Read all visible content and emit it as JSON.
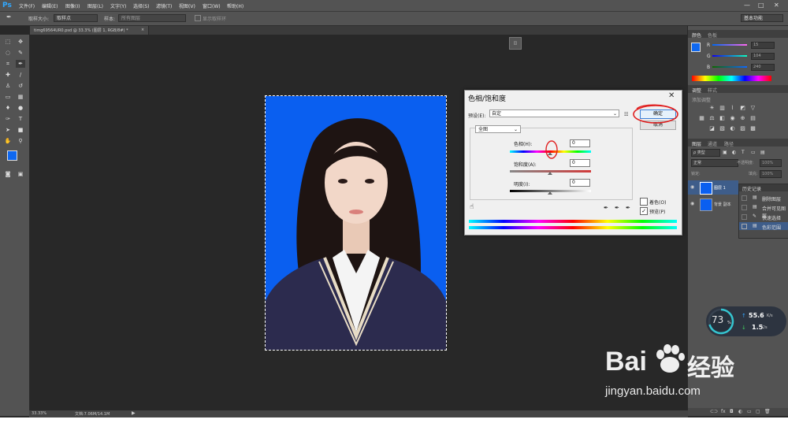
{
  "app": {
    "logo": "Ps"
  },
  "menu": [
    "文件(F)",
    "编辑(E)",
    "图像(I)",
    "图层(L)",
    "文字(Y)",
    "选择(S)",
    "滤镜(T)",
    "视图(V)",
    "窗口(W)",
    "帮助(H)"
  ],
  "window_controls": {
    "minimize": "—",
    "maximize": "□",
    "close": "✕"
  },
  "options": {
    "sample_size_label": "取样大小:",
    "sample_size_value": "取样点",
    "sample_label": "样本:",
    "sample_value": "所有图层",
    "show_ring_label": "显示取样环",
    "workspace": "基本功能"
  },
  "document": {
    "tab_title": "timg69564UR0.psd @ 33.3% (图层 1, RGB/8#) *",
    "tab_close": "×"
  },
  "tools": [
    "move-tool",
    "marquee-tool",
    "lasso-tool",
    "quick-select-tool",
    "crop-tool",
    "eyedropper-tool",
    "healing-tool",
    "brush-tool",
    "stamp-tool",
    "history-brush-tool",
    "eraser-tool",
    "gradient-tool",
    "blur-tool",
    "dodge-tool",
    "pen-tool",
    "type-tool",
    "path-select-tool",
    "shape-tool",
    "hand-tool",
    "zoom-tool"
  ],
  "dialog": {
    "title": "色相/饱和度",
    "close": "✕",
    "preset_label": "预设(E):",
    "preset_value": "自定",
    "ok": "确定",
    "cancel": "取消",
    "channel": "全图",
    "hue_label": "色相(H):",
    "hue_value": "0",
    "saturation_label": "饱和度(A):",
    "saturation_value": "0",
    "lightness_label": "明度(I):",
    "lightness_value": "0",
    "colorize_label": "着色(O)",
    "preview_label": "预览(P)",
    "colorize_checked": false,
    "preview_checked": true
  },
  "panels": {
    "color_tab": "颜色",
    "swatches_tab": "色板",
    "color_r_label": "R",
    "color_g_label": "G",
    "color_b_label": "B",
    "color_r": "15",
    "color_g": "104",
    "color_b": "240",
    "adjust_tab": "调整",
    "styles_tab": "样式",
    "adjust_add": "添加调整",
    "layers_tab": "图层",
    "channels_tab": "通道",
    "paths_tab": "路径",
    "kind_label": "ρ 类型",
    "blend_mode": "正常",
    "opacity_label": "不透明度:",
    "opacity_value": "100%",
    "lock_label": "锁定:",
    "fill_label": "填充:",
    "fill_value": "100%",
    "layers": [
      {
        "name": "图层 1"
      },
      {
        "name": "背景 副本"
      }
    ],
    "history_title": "历史记录",
    "history": [
      "删除图层",
      "合并可见图层",
      "快速选择",
      "色彩范围"
    ]
  },
  "status": {
    "zoom": "33.33%",
    "doc": "文档:7.06M/14.1M"
  },
  "netwidget": {
    "percent": "73",
    "percent_sign": "%",
    "up": "55.6",
    "up_unit": "K/s",
    "down": "1.5",
    "down_unit": "K/s"
  },
  "watermark": {
    "brand": "Bai",
    "brand2": "经验",
    "url": "jingyan.baidu.com"
  },
  "colors": {
    "photo_bg": "#0a5ff0",
    "accent": "#31a8ff",
    "fg_swatch": "#0f68f0"
  }
}
